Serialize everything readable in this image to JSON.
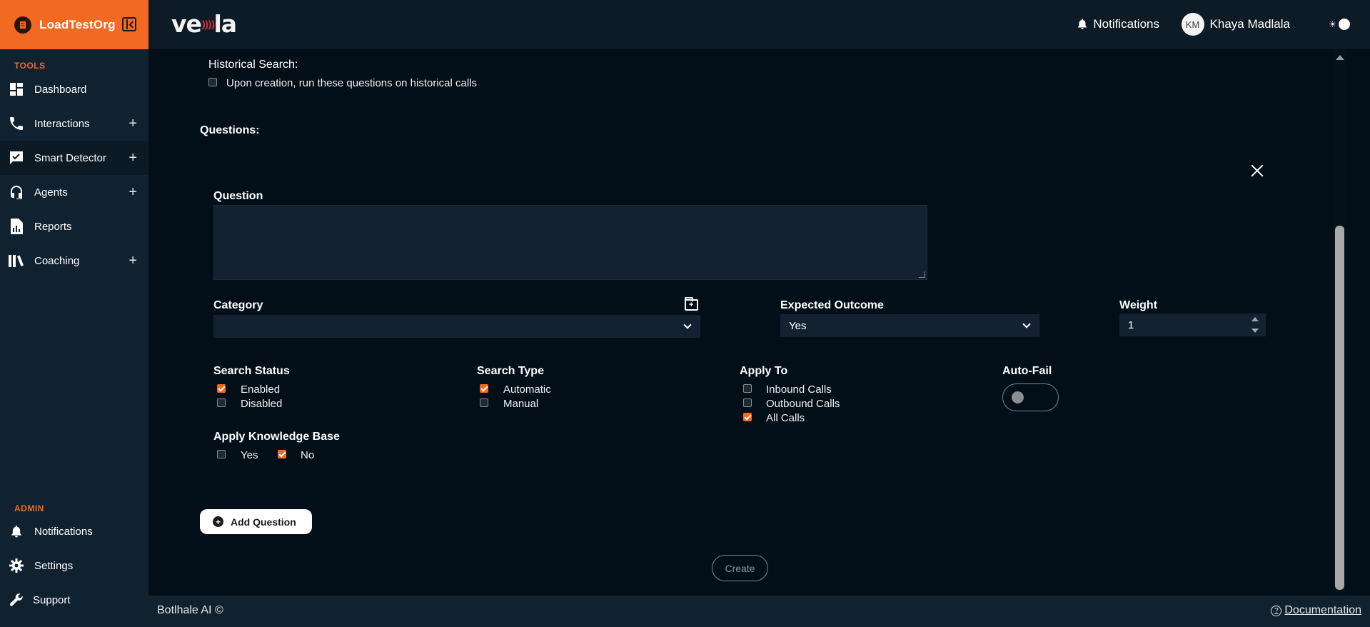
{
  "org": {
    "name": "LoadTestOrg"
  },
  "header": {
    "logo": "ve",
    "logo_tail": "la",
    "notifications_label": "Notifications",
    "user_initials": "KM",
    "user_name": "Khaya Madlala"
  },
  "sidebar": {
    "tools_label": "TOOLS",
    "admin_label": "ADMIN",
    "tools": [
      {
        "label": "Dashboard",
        "icon": "dashboard-icon",
        "expandable": false
      },
      {
        "label": "Interactions",
        "icon": "phone-icon",
        "expandable": true
      },
      {
        "label": "Smart Detector",
        "icon": "chat-check-icon",
        "expandable": true
      },
      {
        "label": "Agents",
        "icon": "headset-icon",
        "expandable": true
      },
      {
        "label": "Reports",
        "icon": "report-icon",
        "expandable": false
      },
      {
        "label": "Coaching",
        "icon": "books-icon",
        "expandable": true
      }
    ],
    "admin": [
      {
        "label": "Notifications",
        "icon": "bell-icon"
      },
      {
        "label": "Settings",
        "icon": "gear-icon"
      },
      {
        "label": "Support",
        "icon": "wrench-icon"
      }
    ]
  },
  "form": {
    "historical_search_label": "Historical Search:",
    "historical_search_option": "Upon creation, run these questions on historical calls",
    "historical_search_checked": false,
    "questions_label": "Questions:",
    "question_label": "Question",
    "question_value": "",
    "category_label": "Category",
    "category_value": "",
    "expected_outcome_label": "Expected Outcome",
    "expected_outcome_value": "Yes",
    "weight_label": "Weight",
    "weight_value": "1",
    "search_status": {
      "label": "Search Status",
      "options": [
        {
          "label": "Enabled",
          "checked": true
        },
        {
          "label": "Disabled",
          "checked": false
        }
      ]
    },
    "search_type": {
      "label": "Search Type",
      "options": [
        {
          "label": "Automatic",
          "checked": true
        },
        {
          "label": "Manual",
          "checked": false
        }
      ]
    },
    "apply_to": {
      "label": "Apply To",
      "options": [
        {
          "label": "Inbound Calls",
          "checked": false
        },
        {
          "label": "Outbound Calls",
          "checked": false
        },
        {
          "label": "All Calls",
          "checked": true
        }
      ]
    },
    "auto_fail": {
      "label": "Auto-Fail",
      "on": false
    },
    "knowledge_base": {
      "label": "Apply Knowledge Base",
      "options": [
        {
          "label": "Yes",
          "checked": false
        },
        {
          "label": "No",
          "checked": true
        }
      ]
    },
    "add_question_label": "Add Question",
    "create_label": "Create"
  },
  "footer": {
    "left": "Botlhale AI ©",
    "right": "Documentation"
  },
  "colors": {
    "accent": "#f26a21",
    "background": "#030f18",
    "sidebar": "#102130",
    "header": "#0d1b26",
    "input": "#142130"
  }
}
